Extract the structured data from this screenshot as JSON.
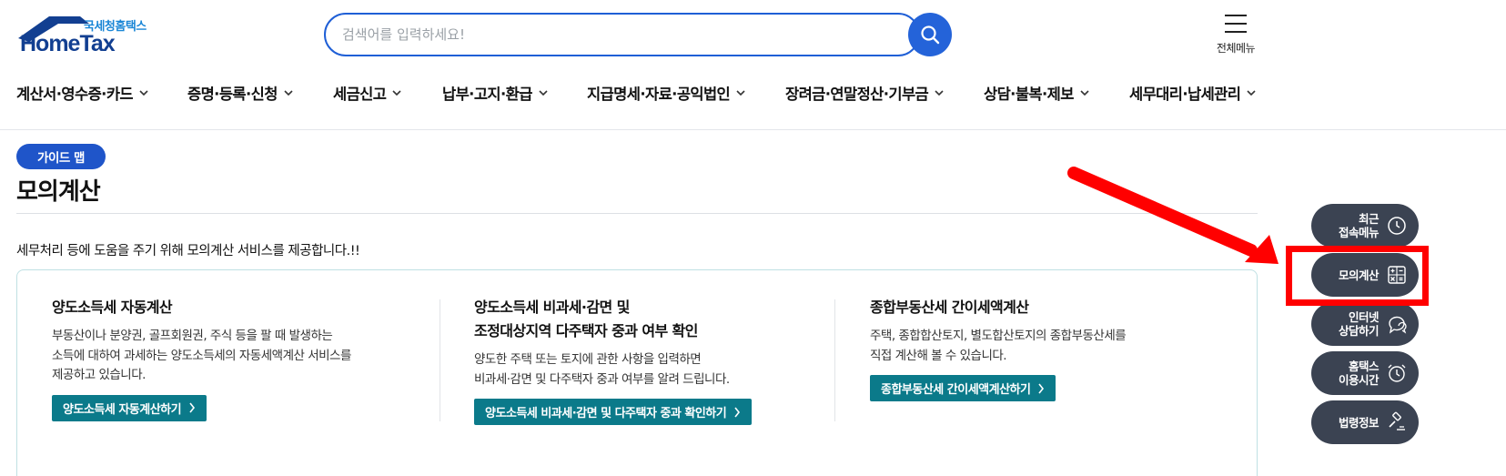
{
  "logo": {
    "sub": "국세청홈택스",
    "main": "HomeTax"
  },
  "search": {
    "placeholder": "검색어를 입력하세요!"
  },
  "allmenu": {
    "label": "전체메뉴"
  },
  "gnb": [
    "계산서·영수증·카드",
    "증명·등록·신청",
    "세금신고",
    "납부·고지·환급",
    "지급명세·자료·공익법인",
    "장려금·연말정산·기부금",
    "상담·불복·제보",
    "세무대리·납세관리"
  ],
  "page": {
    "badge": "가이드 맵",
    "title": "모의계산",
    "intro": "세무처리 등에 도움을 주기 위해 모의계산 서비스를 제공합니다.!!"
  },
  "cards": [
    {
      "title_lines": [
        "양도소득세 자동계산"
      ],
      "desc_lines": [
        "부동산이나 분양권, 골프회원권, 주식 등을 팔 때 발생하는",
        "소득에 대하여 과세하는 양도소득세의 자동세액계산 서비스를",
        "제공하고 있습니다."
      ],
      "button": "양도소득세 자동계산하기"
    },
    {
      "title_lines": [
        "양도소득세 비과세·감면 및",
        "조정대상지역 다주택자 중과 여부 확인"
      ],
      "desc_lines": [
        "양도한 주택 또는 토지에 관한 사항을 입력하면",
        "비과세·감면 및 다주택자 중과 여부를 알려 드립니다."
      ],
      "button": "양도소득세 비과세·감면 및 다주택자 중과 확인하기"
    },
    {
      "title_lines": [
        "종합부동산세 간이세액계산"
      ],
      "desc_lines": [
        "주택, 종합합산토지, 별도합산토지의 종합부동산세를",
        "직접 계산해 볼 수 있습니다."
      ],
      "button": "종합부동산세 간이세액계산하기"
    }
  ],
  "quick_menu": [
    {
      "lines": [
        "최근",
        "접속메뉴"
      ],
      "icon": "clock-icon"
    },
    {
      "lines": [
        "모의계산"
      ],
      "icon": "calculator-icon"
    },
    {
      "lines": [
        "인터넷",
        "상담하기"
      ],
      "icon": "chat-icon"
    },
    {
      "lines": [
        "홈택스",
        "이용시간"
      ],
      "icon": "alarm-clock-icon"
    },
    {
      "lines": [
        "법령정보"
      ],
      "icon": "gavel-icon"
    }
  ],
  "colors": {
    "primary": "#1f55c9",
    "teal_button": "#0b7a8a",
    "quick_bg": "#3b4352",
    "annotation": "#ff0000"
  }
}
